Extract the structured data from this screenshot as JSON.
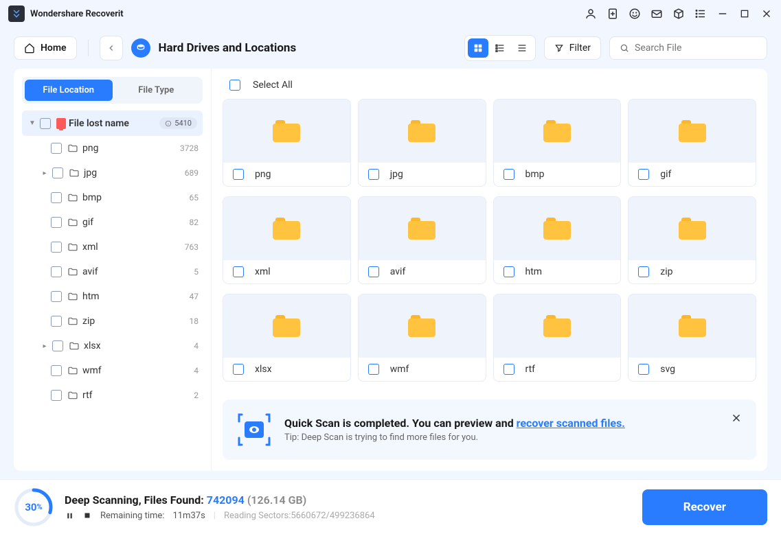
{
  "app_title": "Wondershare Recoverit",
  "home_label": "Home",
  "location_title": "Hard Drives and Locations",
  "filter_label": "Filter",
  "search_placeholder": "Search File",
  "tabs": {
    "file_location": "File Location",
    "file_type": "File Type"
  },
  "tree_root": {
    "label": "File lost name",
    "count": "5410"
  },
  "tree_items": [
    {
      "label": "png",
      "count": "3728",
      "caret": false
    },
    {
      "label": "jpg",
      "count": "689",
      "caret": true
    },
    {
      "label": "bmp",
      "count": "65",
      "caret": false
    },
    {
      "label": "gif",
      "count": "82",
      "caret": false
    },
    {
      "label": "xml",
      "count": "763",
      "caret": false
    },
    {
      "label": "avif",
      "count": "5",
      "caret": false
    },
    {
      "label": "htm",
      "count": "47",
      "caret": false
    },
    {
      "label": "zip",
      "count": "18",
      "caret": false
    },
    {
      "label": "xlsx",
      "count": "4",
      "caret": true
    },
    {
      "label": "wmf",
      "count": "4",
      "caret": false
    },
    {
      "label": "rtf",
      "count": "2",
      "caret": false
    }
  ],
  "select_all_label": "Select All",
  "grid_items": [
    "png",
    "jpg",
    "bmp",
    "gif",
    "xml",
    "avif",
    "htm",
    "zip",
    "xlsx",
    "wmf",
    "rtf",
    "svg"
  ],
  "banner": {
    "title_prefix": "Quick Scan is completed. You can preview and ",
    "title_link": "recover scanned files.",
    "tip": "Tip: Deep Scan is trying to find more files for you."
  },
  "footer": {
    "pct": "30",
    "pct_unit": "%",
    "status_prefix": "Deep Scanning, Files Found: ",
    "files_found": "742094",
    "size": "(126.14 GB)",
    "remaining_label": "Remaining time:",
    "remaining_value": "11m37s",
    "sectors": "Reading Sectors:5660672/499236864",
    "recover_label": "Recover"
  }
}
